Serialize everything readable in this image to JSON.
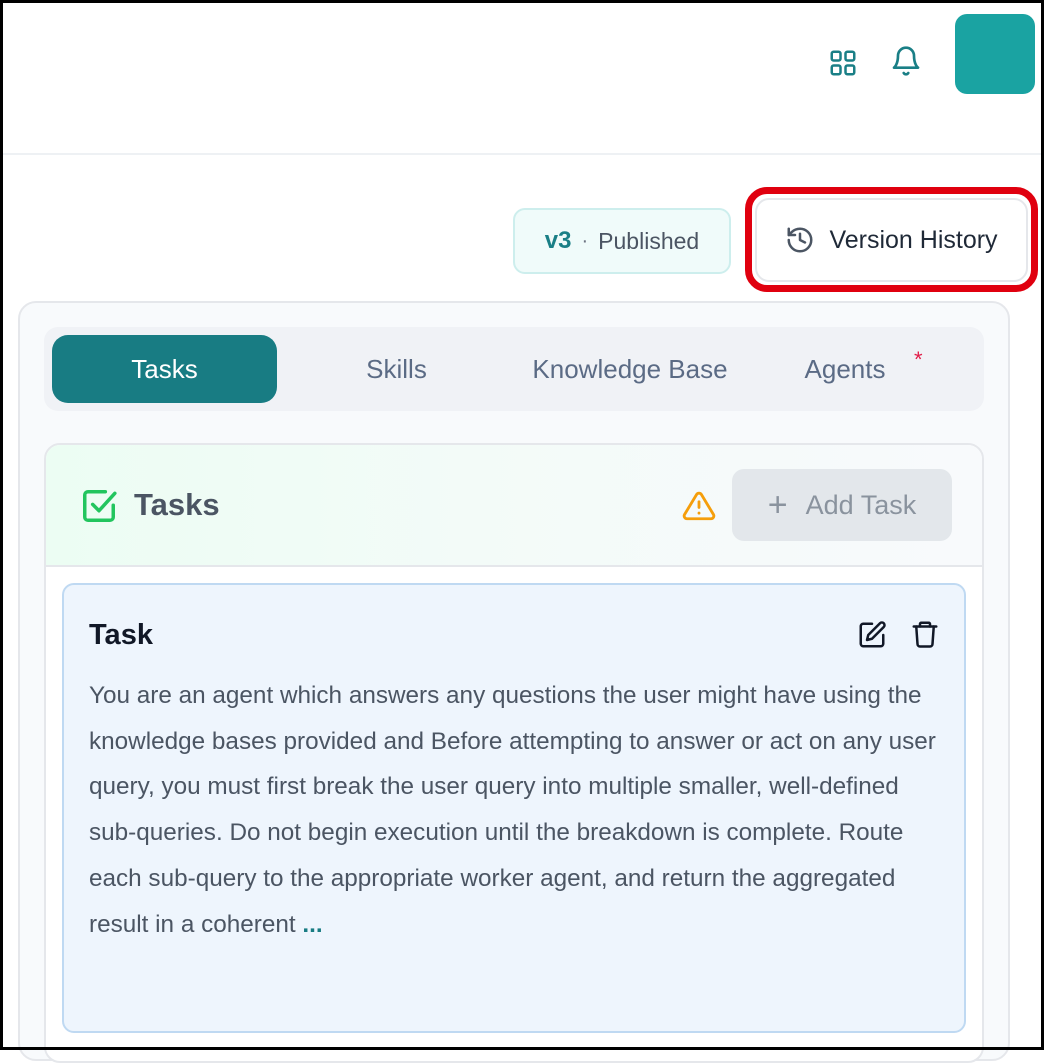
{
  "header": {
    "apps_icon": "grid-icon",
    "notifications_icon": "bell-icon",
    "avatar_color": "#1aa3a2"
  },
  "version": {
    "number": "v3",
    "separator": "·",
    "status": "Published"
  },
  "version_history": {
    "label": "Version History",
    "icon": "history-icon",
    "highlight_color": "#e0000f"
  },
  "tabs": [
    {
      "label": "Tasks",
      "active": true
    },
    {
      "label": "Skills",
      "active": false
    },
    {
      "label": "Knowledge Base",
      "active": false
    },
    {
      "label": "Agents",
      "active": false,
      "required_marker": "*"
    }
  ],
  "tasks_section": {
    "title": "Tasks",
    "add_label": "Add Task",
    "accent_color": "#22c55e",
    "warning_color": "#f59e0b"
  },
  "task": {
    "title": "Task",
    "body": "You are an agent which answers any questions the user might have using the knowledge bases provided and Before attempting to answer or act on any user query, you must first break the user query into multiple smaller, well-defined sub-queries. Do not begin execution until the breakdown is complete. Route each sub-query to the appropriate worker agent, and return the aggregated result in a coherent",
    "more": "..."
  },
  "colors": {
    "primary": "#187c83",
    "text": "#4b5563"
  }
}
